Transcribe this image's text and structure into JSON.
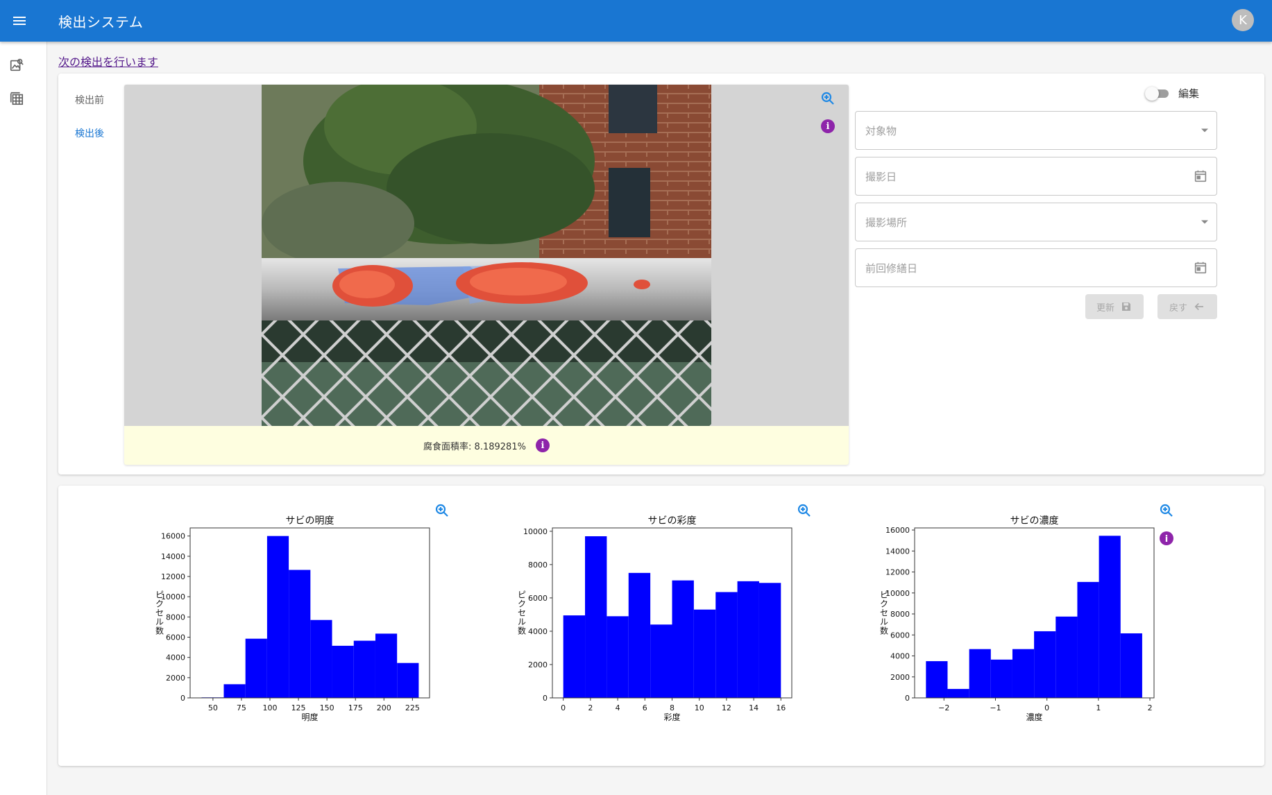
{
  "app": {
    "title": "検出システム",
    "avatar_letter": "K"
  },
  "siderail": [
    {
      "icon": "image-search-icon"
    },
    {
      "icon": "table-icon"
    }
  ],
  "next_link": "次の検出を行います",
  "tabs": [
    {
      "label": "検出前",
      "active": false
    },
    {
      "label": "検出後",
      "active": true
    }
  ],
  "result": {
    "corrosion_label": "腐食面積率: 8.189281%"
  },
  "form": {
    "edit_label": "編集",
    "edit_on": false,
    "fields": {
      "target": "対象物",
      "shoot_date": "撮影日",
      "location": "撮影場所",
      "last_repair": "前回修繕日"
    },
    "update_label": "更新",
    "back_label": "戻す"
  },
  "colors": {
    "appbar": "#1976d2",
    "bar": "#0000ff",
    "info": "#8e24aa",
    "zoom": "#1e88e5"
  },
  "chart_data": [
    {
      "type": "bar",
      "title": "サビの明度",
      "xlabel": "明度",
      "ylabel": "ピクセル数",
      "xlim": [
        30,
        240
      ],
      "ylim": [
        0,
        16800
      ],
      "xticks": [
        50,
        75,
        100,
        125,
        150,
        175,
        200,
        225
      ],
      "xtick_labels": [
        "50",
        "75",
        "100",
        "125",
        "150",
        "175",
        "200",
        "225"
      ],
      "yticks": [
        0,
        2000,
        4000,
        6000,
        8000,
        10000,
        12000,
        14000,
        16000
      ],
      "ytick_labels": [
        "0",
        "2000",
        "4000",
        "6000",
        "8000",
        "10000",
        "12000",
        "14000",
        "16000"
      ],
      "bins": [
        40,
        59.5,
        78.5,
        97.5,
        116.5,
        135.5,
        154.5,
        173.5,
        192.5,
        211.5,
        230.5
      ],
      "values": [
        50,
        1350,
        5850,
        16000,
        12650,
        7700,
        5150,
        5650,
        6350,
        3450
      ],
      "info": false
    },
    {
      "type": "bar",
      "title": "サビの彩度",
      "xlabel": "彩度",
      "ylabel": "ピクセル数",
      "xlim": [
        -0.8,
        16.8
      ],
      "ylim": [
        0,
        10200
      ],
      "xticks": [
        0,
        2,
        4,
        6,
        8,
        10,
        12,
        14,
        16
      ],
      "xtick_labels": [
        "0",
        "2",
        "4",
        "6",
        "8",
        "10",
        "12",
        "14",
        "16"
      ],
      "yticks": [
        0,
        2000,
        4000,
        6000,
        8000,
        10000
      ],
      "ytick_labels": [
        "0",
        "2000",
        "4000",
        "6000",
        "8000",
        "10000"
      ],
      "bins": [
        0,
        1.6,
        3.2,
        4.8,
        6.4,
        8.0,
        9.6,
        11.2,
        12.8,
        14.4,
        16.0
      ],
      "values": [
        4950,
        9700,
        4900,
        7500,
        4400,
        7050,
        5300,
        6350,
        7000,
        6900
      ],
      "info": false
    },
    {
      "type": "bar",
      "title": "サビの濃度",
      "xlabel": "濃度",
      "ylabel": "ピクセル数",
      "xlim": [
        -2.57,
        2.08
      ],
      "ylim": [
        0,
        16200
      ],
      "xticks": [
        -2,
        -1,
        0,
        1,
        2
      ],
      "xtick_labels": [
        "−2",
        "−1",
        "0",
        "1",
        "2"
      ],
      "yticks": [
        0,
        2000,
        4000,
        6000,
        8000,
        10000,
        12000,
        14000,
        16000
      ],
      "ytick_labels": [
        "0",
        "2000",
        "4000",
        "6000",
        "8000",
        "10000",
        "12000",
        "14000",
        "16000"
      ],
      "bins": [
        -2.35,
        -1.93,
        -1.51,
        -1.09,
        -0.67,
        -0.25,
        0.17,
        0.59,
        1.01,
        1.43,
        1.85
      ],
      "values": [
        3500,
        850,
        4650,
        3650,
        4650,
        6350,
        7750,
        11050,
        15450,
        6150
      ],
      "info": true
    }
  ]
}
